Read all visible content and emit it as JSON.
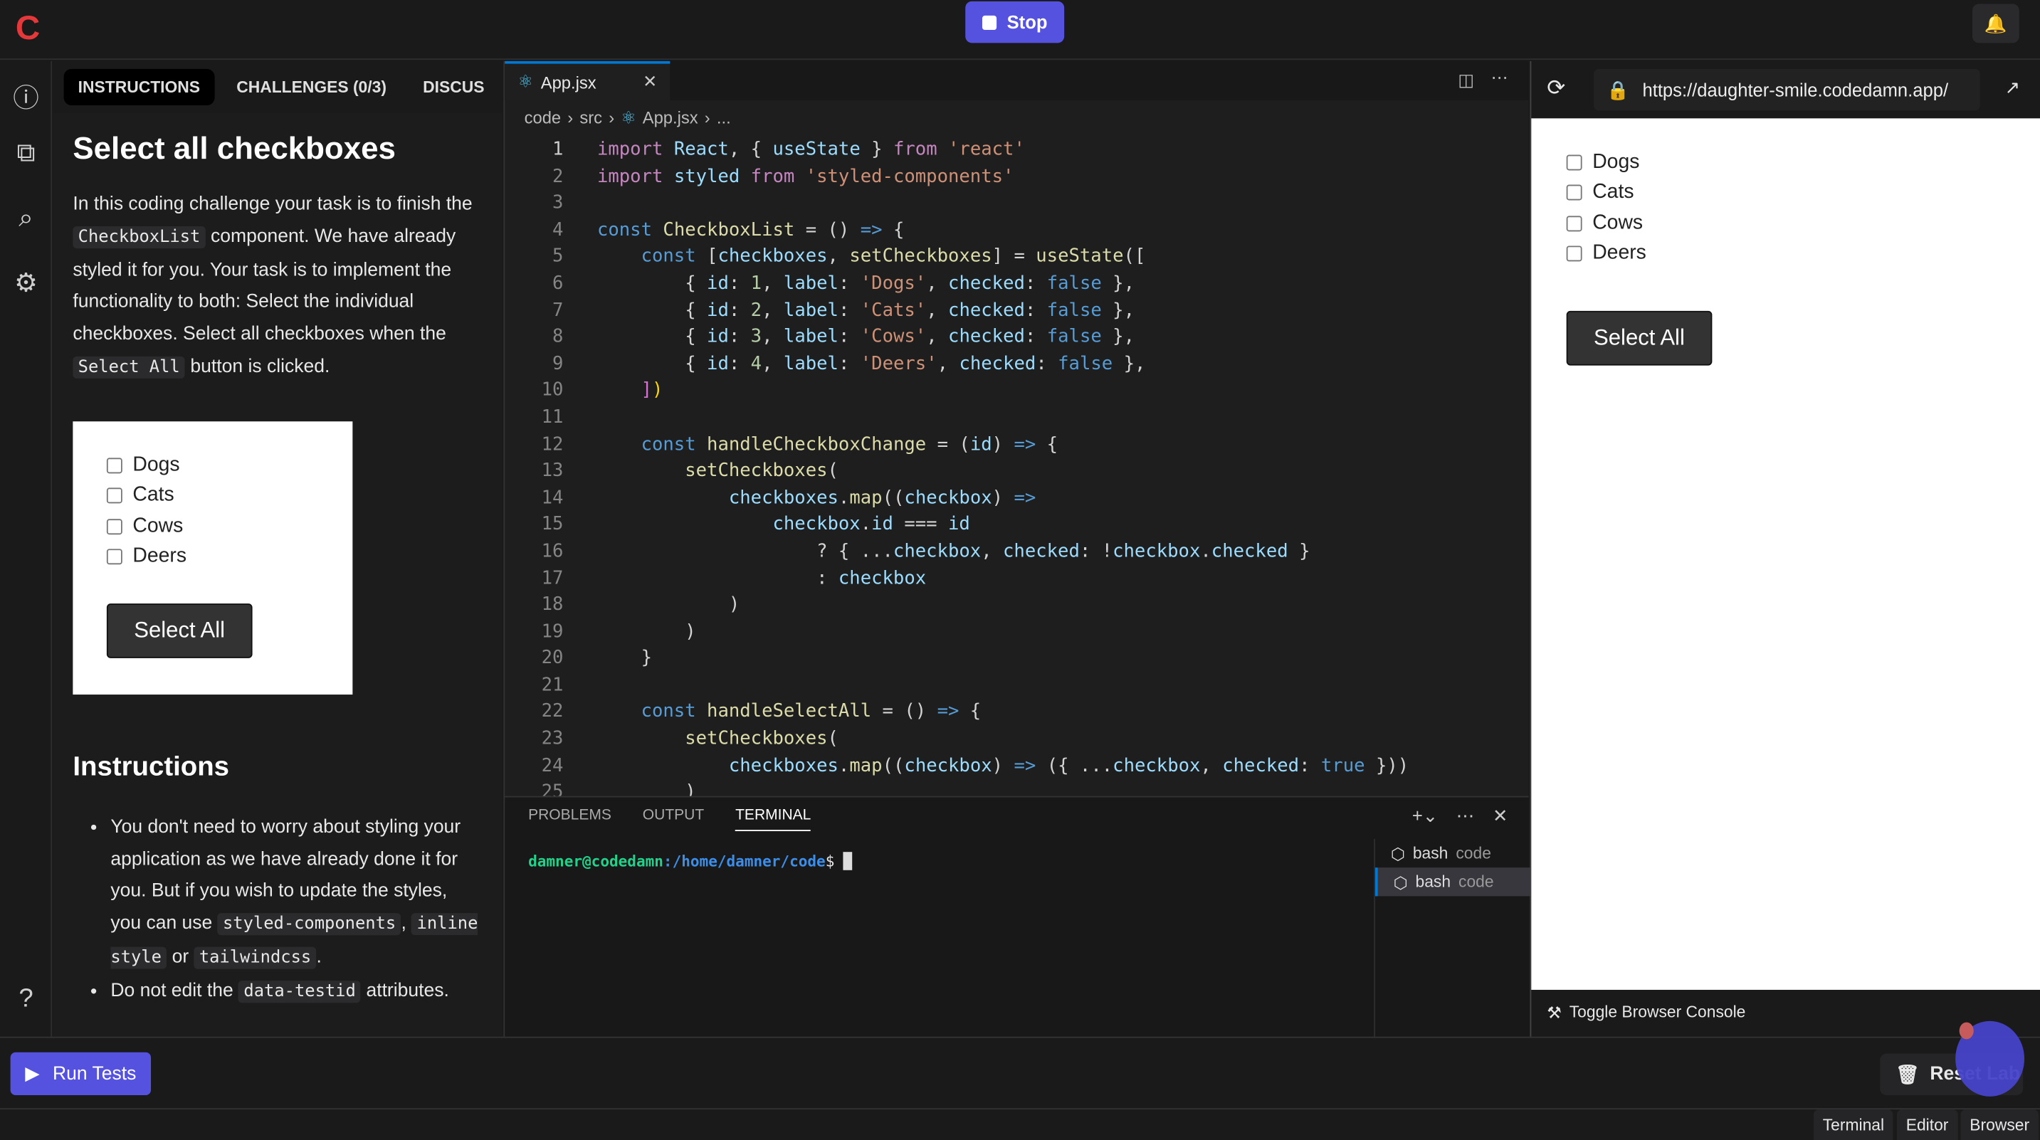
{
  "app": {
    "logo": "C",
    "stop_label": "Stop",
    "bell_icon": "bell-icon"
  },
  "left_panel": {
    "tabs": [
      "INSTRUCTIONS",
      "CHALLENGES (0/3)",
      "DISCUS"
    ],
    "title": "Select all checkboxes",
    "intro": [
      "In this coding challenge your task is to finish the ",
      "CheckboxList",
      " component. We have already styled it for you. Your task is to implement the functionality to both: Select the individual checkboxes. Select all checkboxes when the ",
      "Select All",
      " button is clicked."
    ],
    "preview": {
      "items": [
        "Dogs",
        "Cats",
        "Cows",
        "Deers"
      ],
      "button": "Select All"
    },
    "instructions_title": "Instructions",
    "bullets": [
      [
        "You don't need to worry about styling your application as we have already done it for you. But if you wish to update the styles, you can use ",
        "styled-components",
        ", ",
        "inline style",
        " or ",
        "tailwindcss",
        "."
      ],
      [
        "Do not edit the ",
        "data-testid",
        " attributes."
      ]
    ]
  },
  "editor": {
    "tab": "App.jsx",
    "breadcrumb": [
      "code",
      "src",
      "App.jsx",
      "..."
    ],
    "lines": [
      [
        [
          "k",
          "import"
        ],
        [
          "v",
          " React"
        ],
        [
          "p",
          ", { "
        ],
        [
          "v",
          "useState"
        ],
        [
          "p",
          " } "
        ],
        [
          "k",
          "from"
        ],
        [
          "s",
          " 'react'"
        ]
      ],
      [
        [
          "k",
          "import"
        ],
        [
          "v",
          " styled "
        ],
        [
          "k",
          "from"
        ],
        [
          "s",
          " 'styled-components'"
        ]
      ],
      [],
      [
        [
          "b",
          "const"
        ],
        [
          "f",
          " CheckboxList"
        ],
        [
          "p",
          " = () "
        ],
        [
          "b",
          "=>"
        ],
        [
          "p",
          " {"
        ]
      ],
      [
        [
          "p",
          "    "
        ],
        [
          "b",
          "const"
        ],
        [
          "p",
          " ["
        ],
        [
          "v",
          "checkboxes"
        ],
        [
          "p",
          ", "
        ],
        [
          "f",
          "setCheckboxes"
        ],
        [
          "p",
          "] = "
        ],
        [
          "f",
          "useState"
        ],
        [
          "p",
          "(["
        ]
      ],
      [
        [
          "p",
          "        { "
        ],
        [
          "v",
          "id"
        ],
        [
          "p",
          ": "
        ],
        [
          "m",
          "1"
        ],
        [
          "p",
          ", "
        ],
        [
          "v",
          "label"
        ],
        [
          "p",
          ": "
        ],
        [
          "s",
          "'Dogs'"
        ],
        [
          "p",
          ", "
        ],
        [
          "v",
          "checked"
        ],
        [
          "p",
          ": "
        ],
        [
          "b",
          "false"
        ],
        [
          "p",
          " },"
        ]
      ],
      [
        [
          "p",
          "        { "
        ],
        [
          "v",
          "id"
        ],
        [
          "p",
          ": "
        ],
        [
          "m",
          "2"
        ],
        [
          "p",
          ", "
        ],
        [
          "v",
          "label"
        ],
        [
          "p",
          ": "
        ],
        [
          "s",
          "'Cats'"
        ],
        [
          "p",
          ", "
        ],
        [
          "v",
          "checked"
        ],
        [
          "p",
          ": "
        ],
        [
          "b",
          "false"
        ],
        [
          "p",
          " },"
        ]
      ],
      [
        [
          "p",
          "        { "
        ],
        [
          "v",
          "id"
        ],
        [
          "p",
          ": "
        ],
        [
          "m",
          "3"
        ],
        [
          "p",
          ", "
        ],
        [
          "v",
          "label"
        ],
        [
          "p",
          ": "
        ],
        [
          "s",
          "'Cows'"
        ],
        [
          "p",
          ", "
        ],
        [
          "v",
          "checked"
        ],
        [
          "p",
          ": "
        ],
        [
          "b",
          "false"
        ],
        [
          "p",
          " },"
        ]
      ],
      [
        [
          "p",
          "        { "
        ],
        [
          "v",
          "id"
        ],
        [
          "p",
          ": "
        ],
        [
          "m",
          "4"
        ],
        [
          "p",
          ", "
        ],
        [
          "v",
          "label"
        ],
        [
          "p",
          ": "
        ],
        [
          "s",
          "'Deers'"
        ],
        [
          "p",
          ", "
        ],
        [
          "v",
          "checked"
        ],
        [
          "p",
          ": "
        ],
        [
          "b",
          "false"
        ],
        [
          "p",
          " },"
        ]
      ],
      [
        [
          "p",
          "    "
        ],
        [
          "w",
          "]"
        ],
        [
          "y",
          ")"
        ]
      ],
      [],
      [
        [
          "p",
          "    "
        ],
        [
          "b",
          "const"
        ],
        [
          "f",
          " handleCheckboxChange"
        ],
        [
          "p",
          " = ("
        ],
        [
          "v",
          "id"
        ],
        [
          "p",
          ") "
        ],
        [
          "b",
          "=>"
        ],
        [
          "p",
          " {"
        ]
      ],
      [
        [
          "p",
          "        "
        ],
        [
          "f",
          "setCheckboxes"
        ],
        [
          "p",
          "("
        ]
      ],
      [
        [
          "p",
          "            "
        ],
        [
          "v",
          "checkboxes"
        ],
        [
          "p",
          "."
        ],
        [
          "f",
          "map"
        ],
        [
          "p",
          "(("
        ],
        [
          "v",
          "checkbox"
        ],
        [
          "p",
          ") "
        ],
        [
          "b",
          "=>"
        ]
      ],
      [
        [
          "p",
          "                "
        ],
        [
          "v",
          "checkbox"
        ],
        [
          "p",
          "."
        ],
        [
          "v",
          "id"
        ],
        [
          "p",
          " === "
        ],
        [
          "v",
          "id"
        ]
      ],
      [
        [
          "p",
          "                    ? { ..."
        ],
        [
          "v",
          "checkbox"
        ],
        [
          "p",
          ", "
        ],
        [
          "v",
          "checked"
        ],
        [
          "p",
          ": !"
        ],
        [
          "v",
          "checkbox"
        ],
        [
          "p",
          "."
        ],
        [
          "v",
          "checked"
        ],
        [
          "p",
          " }"
        ]
      ],
      [
        [
          "p",
          "                    : "
        ],
        [
          "v",
          "checkbox"
        ]
      ],
      [
        [
          "p",
          "            )"
        ]
      ],
      [
        [
          "p",
          "        )"
        ]
      ],
      [
        [
          "p",
          "    }"
        ]
      ],
      [],
      [
        [
          "p",
          "    "
        ],
        [
          "b",
          "const"
        ],
        [
          "f",
          " handleSelectAll"
        ],
        [
          "p",
          " = () "
        ],
        [
          "b",
          "=>"
        ],
        [
          "p",
          " {"
        ]
      ],
      [
        [
          "p",
          "        "
        ],
        [
          "f",
          "setCheckboxes"
        ],
        [
          "p",
          "("
        ]
      ],
      [
        [
          "p",
          "            "
        ],
        [
          "v",
          "checkboxes"
        ],
        [
          "p",
          "."
        ],
        [
          "f",
          "map"
        ],
        [
          "p",
          "(("
        ],
        [
          "v",
          "checkbox"
        ],
        [
          "p",
          ") "
        ],
        [
          "b",
          "=>"
        ],
        [
          "p",
          " ({ ..."
        ],
        [
          "v",
          "checkbox"
        ],
        [
          "p",
          ", "
        ],
        [
          "v",
          "checked"
        ],
        [
          "p",
          ": "
        ],
        [
          "b",
          "true"
        ],
        [
          "p",
          " }))"
        ]
      ],
      [
        [
          "p",
          "        )"
        ]
      ]
    ]
  },
  "panel": {
    "tabs": [
      "PROBLEMS",
      "OUTPUT",
      "TERMINAL"
    ],
    "prompt_user": "damner@codedamn",
    "prompt_path": ":/home/damner/code",
    "prompt_suffix": "$",
    "terminals": [
      {
        "name": "bash",
        "cwd": "code"
      },
      {
        "name": "bash",
        "cwd": "code"
      }
    ]
  },
  "browser": {
    "url": "https://daughter-smile.codedamn.app/",
    "items": [
      "Dogs",
      "Cats",
      "Cows",
      "Deers"
    ],
    "button": "Select All",
    "console_toggle": "Toggle Browser Console"
  },
  "bottom": {
    "run_tests": "Run Tests",
    "reset_lab": "Reset Lab"
  },
  "status": {
    "buttons": [
      "Terminal",
      "Editor",
      "Browser"
    ]
  },
  "colors": {
    "accent": "#5552e0",
    "logo": "#e5383b",
    "editor_tab_border": "#0078d4"
  }
}
